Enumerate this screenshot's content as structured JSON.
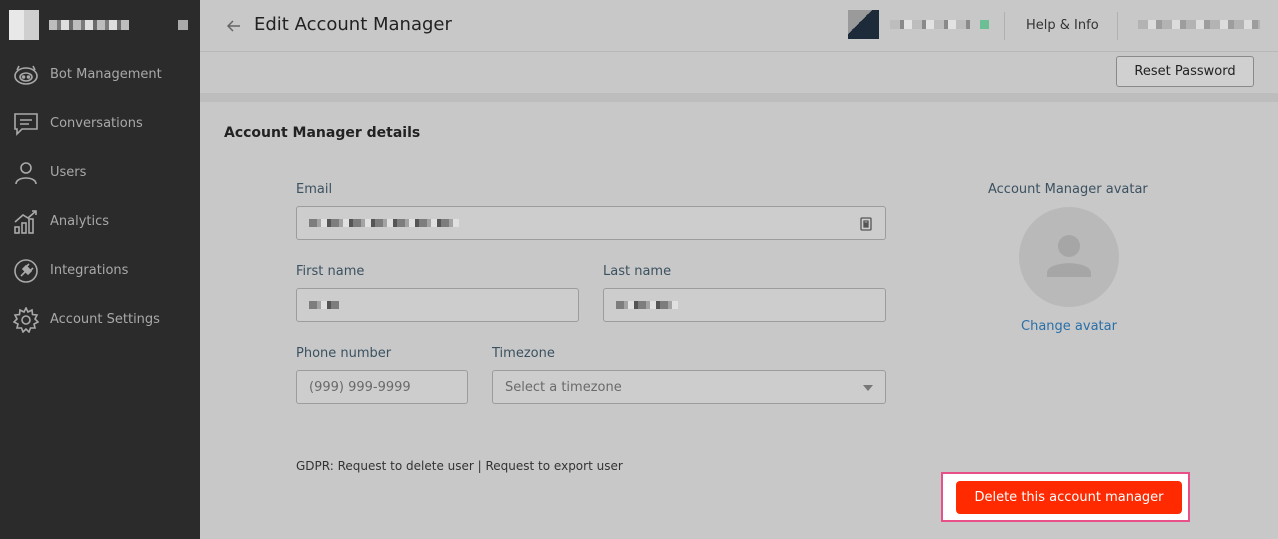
{
  "sidebar": {
    "items": [
      {
        "label": "Bot Management",
        "icon": "bot-icon"
      },
      {
        "label": "Conversations",
        "icon": "chat-icon"
      },
      {
        "label": "Users",
        "icon": "user-icon"
      },
      {
        "label": "Analytics",
        "icon": "analytics-icon"
      },
      {
        "label": "Integrations",
        "icon": "plug-icon"
      },
      {
        "label": "Account Settings",
        "icon": "gear-icon"
      }
    ]
  },
  "header": {
    "title": "Edit Account Manager",
    "help_label": "Help & Info"
  },
  "toolbar": {
    "reset_password_label": "Reset Password"
  },
  "form": {
    "section_title": "Account Manager details",
    "email_label": "Email",
    "first_name_label": "First name",
    "last_name_label": "Last name",
    "phone_label": "Phone number",
    "phone_placeholder": "(999) 999-9999",
    "timezone_label": "Timezone",
    "timezone_value": "Select a timezone"
  },
  "avatar": {
    "label": "Account Manager avatar",
    "change_label": "Change avatar"
  },
  "gdpr": {
    "prefix": "GDPR: ",
    "delete_link": "Request to delete user",
    "separator": " | ",
    "export_link": "Request to export user"
  },
  "danger": {
    "delete_label": "Delete this account manager"
  },
  "colors": {
    "sidebar_bg": "#2b2b2b",
    "danger": "#ff2a00",
    "highlight_border": "#e8508a",
    "link": "#2a6fa8"
  }
}
